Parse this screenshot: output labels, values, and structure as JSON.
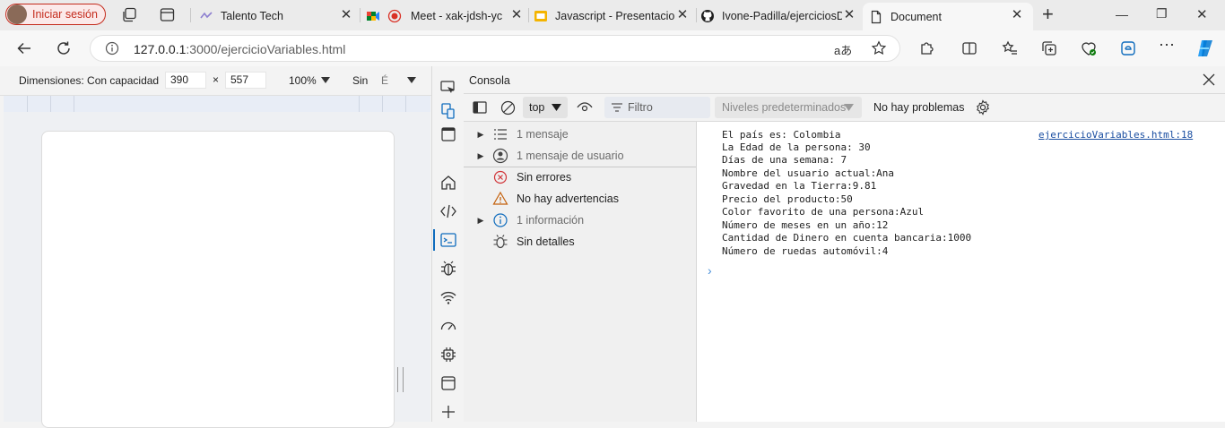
{
  "tabs": {
    "signin_label": "Iniciar sesión",
    "items": [
      {
        "title": "Talento Tech",
        "close": "✕"
      },
      {
        "title": "Meet - xak-jdsh-yc",
        "close": "✕"
      },
      {
        "title": "Javascript - Presentacion",
        "close": "✕"
      },
      {
        "title": "Ivone-Padilla/ejerciciosD",
        "close": "✕"
      },
      {
        "title": "Document",
        "close": "✕"
      }
    ],
    "new_tab": "+",
    "window": {
      "minimize": "—",
      "restore": "❐",
      "close": "✕"
    }
  },
  "address": {
    "url_host": "127.0.0.1",
    "url_rest": ":3000/ejercicioVariables.html",
    "read_aloud": "aあ"
  },
  "device_toolbar": {
    "dimensions_label": "Dimensiones: Con capacidad c",
    "width": "390",
    "times": "×",
    "height": "557",
    "zoom": "100%",
    "throttle": "Sin",
    "extra": "É"
  },
  "console": {
    "title": "Consola",
    "context": "top",
    "filter_placeholder": "Filtro",
    "levels": "Niveles predeterminados",
    "issues": "No hay problemas",
    "sidebar": [
      {
        "label": "1 mensaje",
        "expand": "▶",
        "icon": "list-icon",
        "dim": true
      },
      {
        "label": "1 mensaje de usuario",
        "expand": "▶",
        "icon": "user-icon",
        "dim": true
      },
      {
        "label": "Sin errores",
        "expand": "",
        "icon": "error-icon",
        "dim": false
      },
      {
        "label": "No hay advertencias",
        "expand": "",
        "icon": "warning-icon",
        "dim": false
      },
      {
        "label": "1 información",
        "expand": "▶",
        "icon": "info-icon",
        "dim": true
      },
      {
        "label": "Sin detalles",
        "expand": "",
        "icon": "bug-icon",
        "dim": false
      }
    ],
    "source_link": "ejercicioVariables.html:18",
    "log_lines": [
      "El país es: Colombia",
      "La Edad de la persona: 30",
      "Días de una semana: 7",
      "Nombre del usuario actual:Ana",
      "Gravedad en la Tierra:9.81",
      "Precio del producto:50",
      "Color favorito de una persona:Azul",
      "Número de meses en un año:12",
      "Cantidad de Dinero en cuenta bancaria:1000",
      "Número de ruedas automóvil:4"
    ],
    "prompt": "›"
  },
  "colors": {
    "accent": "#0f6cbd",
    "signin": "#c42b1c",
    "link": "#1a4ea1"
  }
}
